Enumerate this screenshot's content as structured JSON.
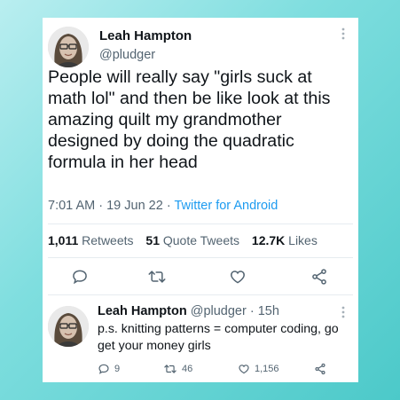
{
  "main_tweet": {
    "author_name": "Leah Hampton",
    "author_handle": "@pludger",
    "text": "People will really say \"girls suck at math lol\" and then be like look at this amazing quilt my grandmother designed by doing the quadratic formula in her head",
    "time": "7:01 AM",
    "date": "19 Jun 22",
    "separator": "·",
    "source": "Twitter for Android",
    "retweets_count": "1,011",
    "retweets_label": "Retweets",
    "quote_count": "51",
    "quote_label": "Quote Tweets",
    "likes_count": "12.7K",
    "likes_label": "Likes"
  },
  "reply": {
    "author_name": "Leah Hampton",
    "author_handle": "@pludger",
    "age": "· 15h",
    "text": "p.s. knitting patterns = computer coding, go get your money girls",
    "reply_count": "9",
    "retweet_count": "46",
    "like_count": "1,156"
  },
  "icons": [
    "more-icon",
    "reply-icon",
    "retweet-icon",
    "like-icon",
    "share-icon"
  ],
  "colors": {
    "link": "#1d9bf0",
    "text": "#0f1419",
    "muted": "#536471"
  }
}
